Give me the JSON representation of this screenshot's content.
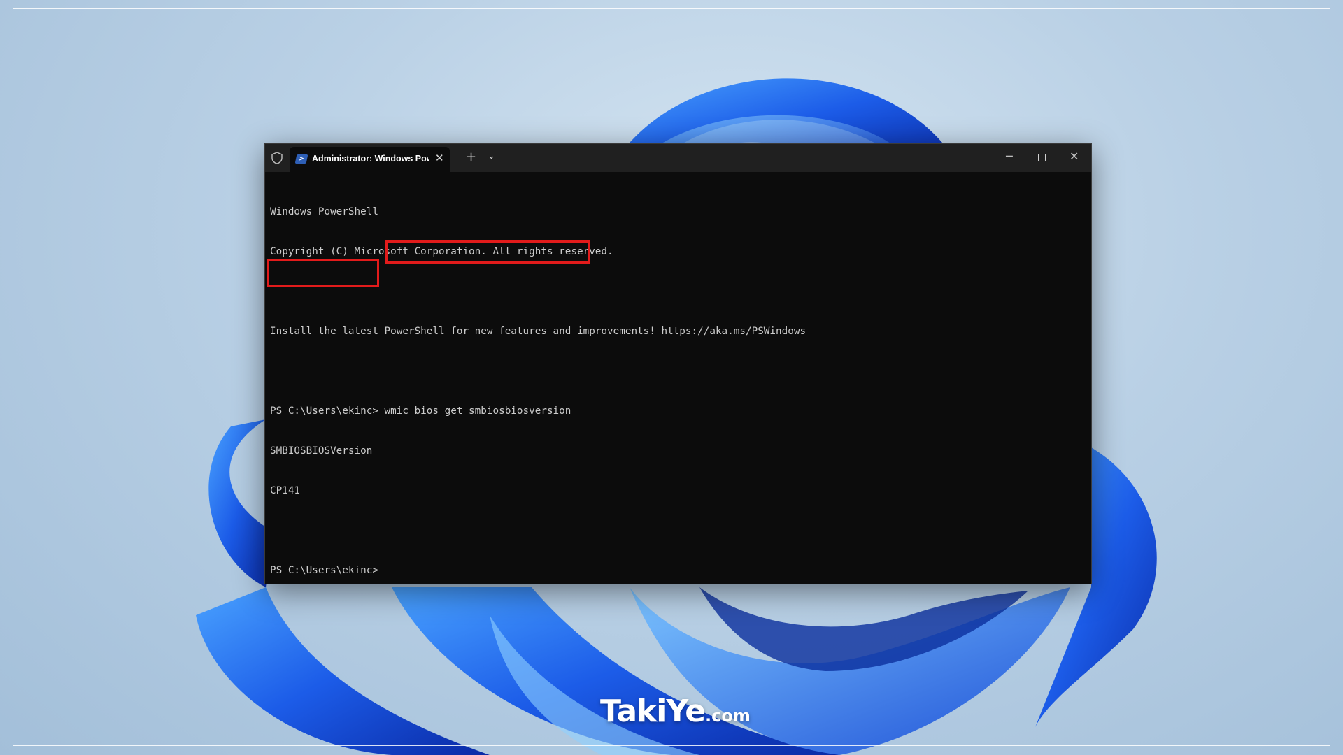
{
  "window": {
    "tab_title": "Administrator: Windows Powe",
    "tab_icon": "powershell-icon",
    "controls": [
      "shield-icon",
      "new-tab-icon",
      "chevron-down-icon",
      "minimize-icon",
      "maximize-icon",
      "close-icon"
    ]
  },
  "console": {
    "lines": [
      "Windows PowerShell",
      "Copyright (C) Microsoft Corporation. All rights reserved.",
      "",
      "Install the latest PowerShell for new features and improvements! https://aka.ms/PSWindows",
      "",
      "PS C:\\Users\\ekinc> wmic bios get smbiosbiosversion",
      "SMBIOSBIOSVersion",
      "CP141",
      "",
      "PS C:\\Users\\ekinc>"
    ]
  },
  "highlights": {
    "command": "wmic bios get smbiosbiosversion",
    "output_header": "SMBIOSBIOSVersion",
    "output_value": "CP141",
    "color": "#e21b1b"
  },
  "watermark": {
    "brand": "TakiYe",
    "suffix": ".com"
  },
  "colors": {
    "terminal_bg": "#0c0c0c",
    "titlebar_bg": "#202020",
    "text": "#cccccc"
  }
}
